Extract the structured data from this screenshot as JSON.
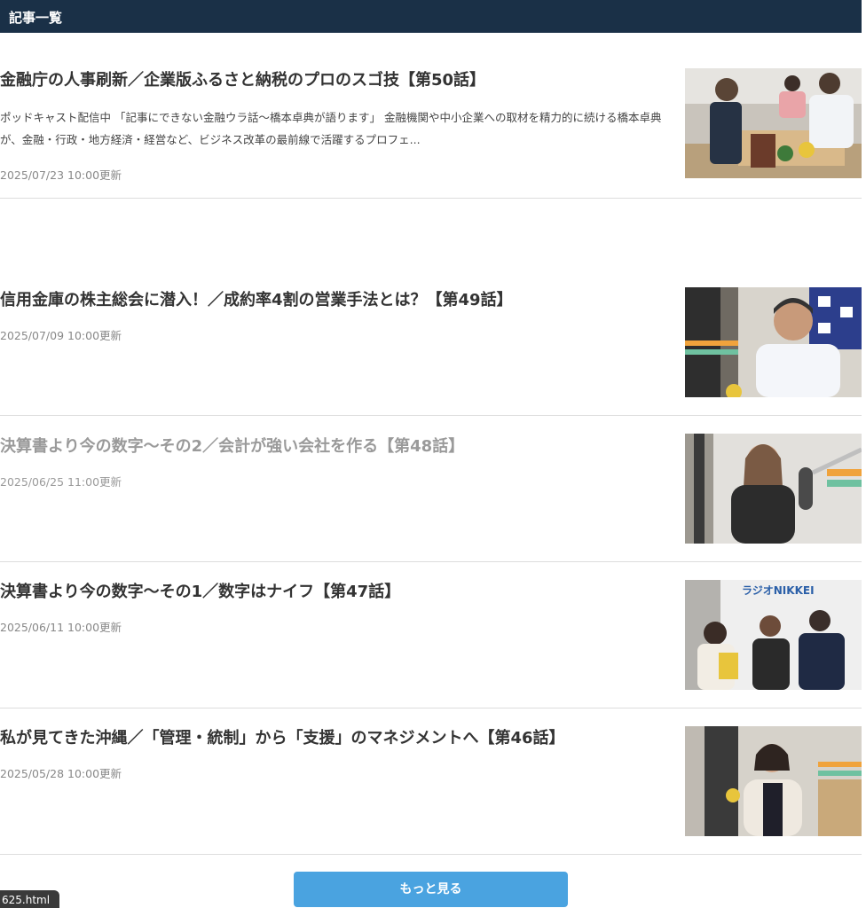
{
  "header": {
    "title": "記事一覧"
  },
  "articles": [
    {
      "title": "金融庁の人事刷新／企業版ふるさと納税のプロのスゴ技【第50話】",
      "excerpt": "ポッドキャスト配信中 「記事にできない金融ウラ話〜橋本卓典が語ります」 金融機関や中小企業への取材を精力的に続ける橋本卓典が、金融・行政・地方経済・経営など、ビジネス改革の最前線で活躍するプロフェ...",
      "date": "2025/07/23 10:00更新"
    },
    {
      "title": "信用金庫の株主総会に潜入！／成約率4割の営業手法とは？【第49話】",
      "date": "2025/07/09 10:00更新"
    },
    {
      "title": "決算書より今の数字〜その2／会計が強い会社を作る【第48話】",
      "date": "2025/06/25 11:00更新"
    },
    {
      "title": "決算書より今の数字〜その1／数字はナイフ【第47話】",
      "date": "2025/06/11 10:00更新"
    },
    {
      "title": "私が見てきた沖縄／「管理・統制」から「支援」のマネジメントへ【第46話】",
      "date": "2025/05/28 10:00更新"
    }
  ],
  "thumb3_sign": "ラジオNIKKEI",
  "more_button": {
    "label": "もっと見る"
  },
  "status_tip": {
    "text": "625.html"
  }
}
